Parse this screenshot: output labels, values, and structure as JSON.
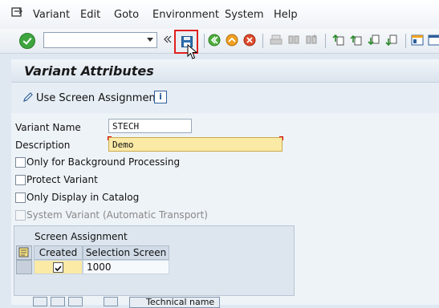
{
  "menu": {
    "items": [
      "Variant",
      "Edit",
      "Goto",
      "Environment",
      "System",
      "Help"
    ]
  },
  "toolbar": {
    "command_value": "",
    "icons": [
      "ok-icon",
      "back-icon",
      "exit-icon",
      "cancel-icon",
      "print-icon",
      "find-icon",
      "find-next-icon",
      "first-page-icon",
      "prev-page-icon",
      "next-page-icon",
      "last-page-icon",
      "layout-icon",
      "settings-icon"
    ]
  },
  "title": "Variant Attributes",
  "appbar": {
    "use_screen_assignment": "Use Screen Assignment",
    "info_icon": "i"
  },
  "form": {
    "variant_name_label": "Variant Name",
    "variant_name_value": "STECH",
    "description_label": "Description",
    "description_value": "Demo",
    "checkboxes": [
      {
        "label": "Only for Background Processing",
        "checked": false,
        "disabled": false
      },
      {
        "label": "Protect Variant",
        "checked": false,
        "disabled": false
      },
      {
        "label": "Only Display in Catalog",
        "checked": false,
        "disabled": false
      },
      {
        "label": "System Variant (Automatic Transport)",
        "checked": false,
        "disabled": true
      }
    ]
  },
  "screen_assignment": {
    "title": "Screen Assignment",
    "columns": [
      "Created",
      "Selection Screen"
    ],
    "rows": [
      {
        "created": true,
        "selection_screen": "1000"
      }
    ]
  },
  "bottom": {
    "technical_name_button": "Technical name"
  },
  "colors": {
    "required_field_bg": "#fbeaa6",
    "highlight_border": "#e02020",
    "ok_green": "#3ea53e"
  }
}
